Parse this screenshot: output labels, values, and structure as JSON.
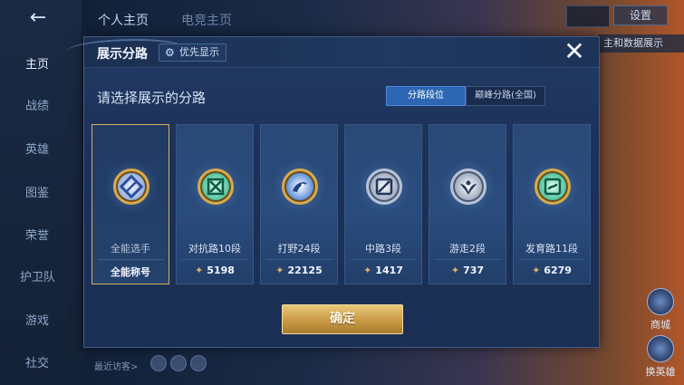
{
  "background": {
    "back_icon": "back-arrow-icon",
    "top_tabs": [
      "个人主页",
      "电竞主页"
    ],
    "settings_label": "设置",
    "right_tag": "主和数据展示",
    "right_buttons": [
      "商城",
      "换英雄"
    ],
    "sidebar": [
      "主页",
      "战绩",
      "英雄",
      "图鉴",
      "荣誉",
      "护卫队",
      "游戏",
      "社交"
    ],
    "visitor_label": "最近访客>"
  },
  "dialog": {
    "title": "展示分路",
    "priority_button": "优先显示",
    "priority_icon": "gear-icon",
    "close_icon": "close-icon",
    "subtitle": "请选择展示的分路",
    "segments": {
      "active": "分路段位",
      "inactive": "巅峰分路(全国)"
    },
    "cards": [
      {
        "label": "全能选手",
        "bottom": "全能称号",
        "badge": "all-rounder-badge-icon",
        "selected": true
      },
      {
        "label": "对抗路10段",
        "score": "5198",
        "badge": "clash-lane-badge-icon"
      },
      {
        "label": "打野24段",
        "score": "22125",
        "badge": "jungle-badge-icon"
      },
      {
        "label": "中路3段",
        "score": "1417",
        "badge": "mid-lane-badge-icon"
      },
      {
        "label": "游走2段",
        "score": "737",
        "badge": "roam-badge-icon"
      },
      {
        "label": "发育路11段",
        "score": "6279",
        "badge": "farm-lane-badge-icon"
      }
    ],
    "rank_icon": "rank-icon",
    "confirm_label": "确定"
  },
  "colors": {
    "dialog_bg": "#1c3158",
    "selected_border": "#d9b160",
    "active_segment": "#2d66b3",
    "confirm_gold": "#c99a45"
  }
}
